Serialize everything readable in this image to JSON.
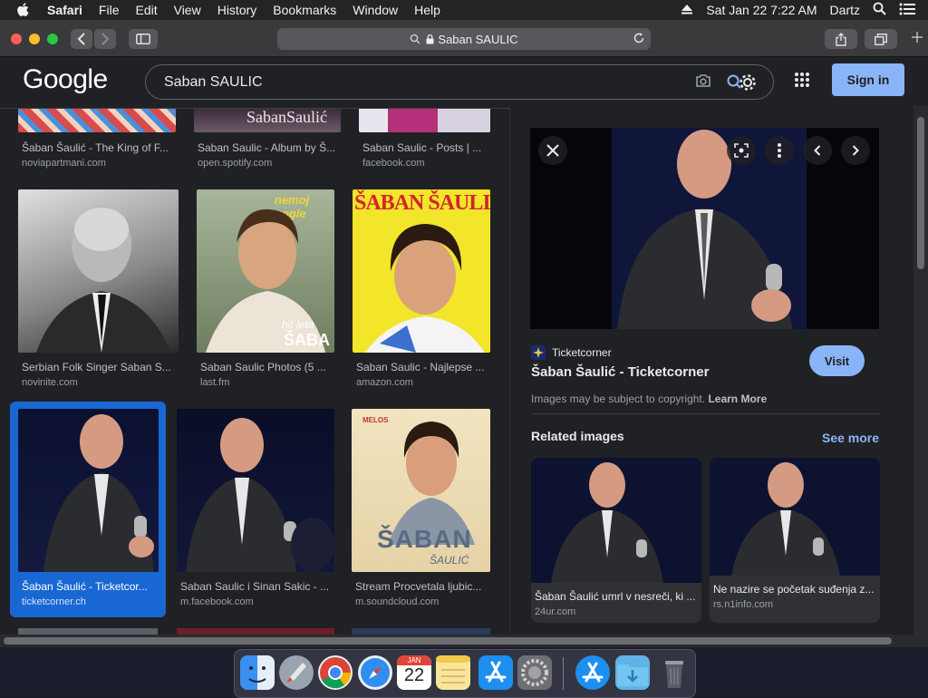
{
  "menubar": {
    "app": "Safari",
    "items": [
      "File",
      "Edit",
      "View",
      "History",
      "Bookmarks",
      "Window",
      "Help"
    ],
    "datetime": "Sat Jan 22  7:22 AM",
    "user": "Dartz"
  },
  "toolbar": {
    "url": "Saban SAULIC"
  },
  "google": {
    "logo": "Google",
    "query": "Saban SAULIC",
    "signin": "Sign in"
  },
  "results": [
    {
      "caption": "Šaban Šaulić - The King of F...",
      "source": "noviapartmani.com"
    },
    {
      "caption": "Saban Saulic - Album by Š...",
      "source": "open.spotify.com"
    },
    {
      "caption": "Saban Saulic - Posts | ...",
      "source": "facebook.com"
    },
    {
      "caption": "Serbian Folk Singer Saban S...",
      "source": "novinite.com"
    },
    {
      "caption": "Saban Saulic Photos (5 ...",
      "source": "last.fm"
    },
    {
      "caption": "Saban Saulic - Najlepse ...",
      "source": "amazon.com"
    },
    {
      "caption": "Šaban Šaulić - Ticketcor...",
      "source": "ticketcorner.ch"
    },
    {
      "caption": "Saban Saulic i Sinan Sakic - ...",
      "source": "m.facebook.com"
    },
    {
      "caption": "Stream Procvetala ljubic...",
      "source": "m.soundcloud.com"
    }
  ],
  "thumb_text": {
    "album": "SabanSaulić",
    "poster_top": "nemoj pogle",
    "poster_mid": "hit leta",
    "poster_bottom": "ŠABA",
    "yellow": "ŠABAN ŠAULIĆ",
    "brand": "MELOS",
    "cover_name": "ŠABAN",
    "cover_sub": "ŠAULIĆ"
  },
  "panel": {
    "site": "Ticketcorner",
    "title": "Šaban Šaulić - Ticketcorner",
    "visit": "Visit",
    "copyright": "Images may be subject to copyright.",
    "learn_more": "Learn More",
    "related": "Related images",
    "see_more": "See more",
    "related_items": [
      {
        "caption": "Šaban Šaulić umrl v nesreči, ki ...",
        "source": "24ur.com"
      },
      {
        "caption": "Ne nazire se početak suđenja z...",
        "source": "rs.n1info.com"
      }
    ]
  },
  "dock": {
    "calendar_month": "JAN",
    "calendar_day": "22"
  }
}
